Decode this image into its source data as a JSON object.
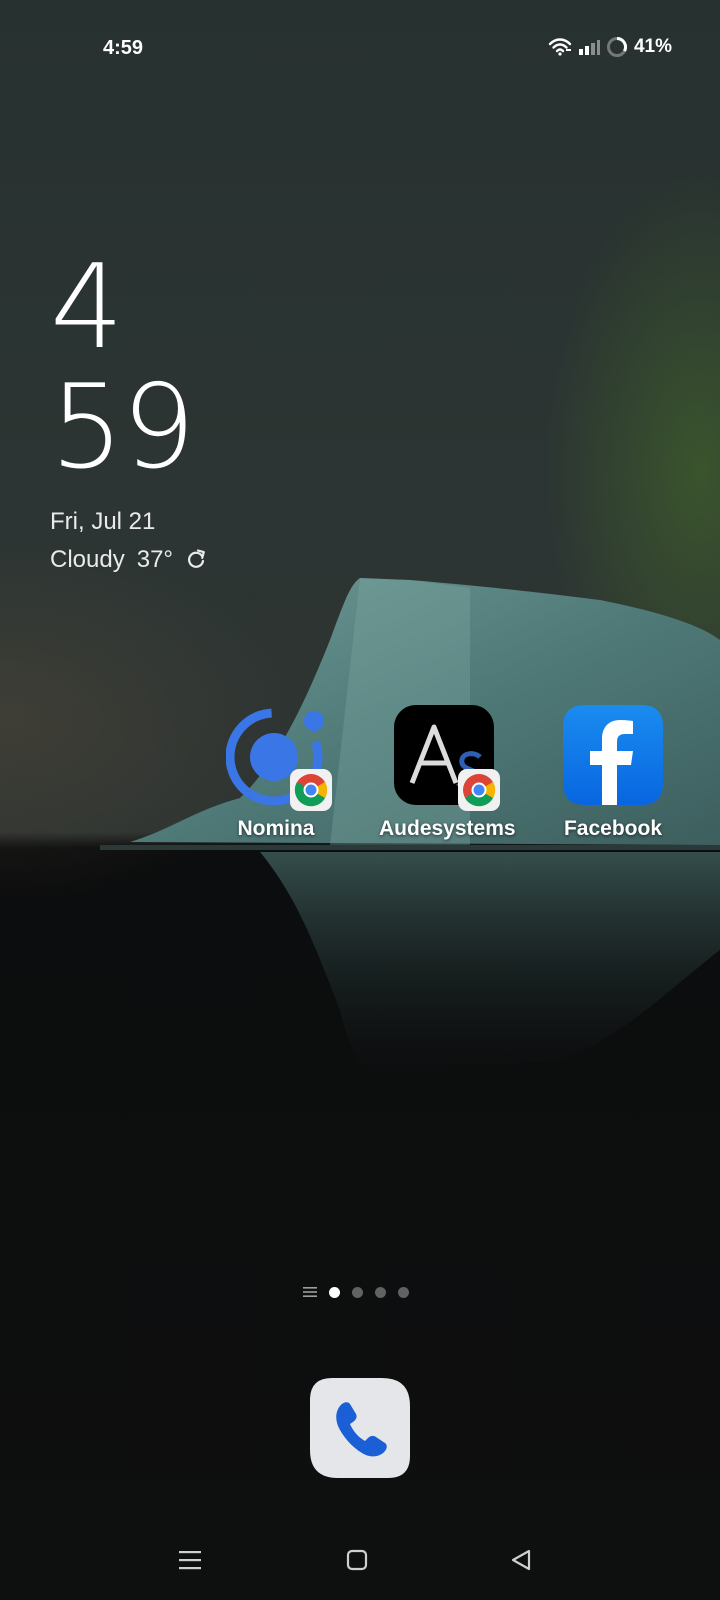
{
  "status_bar": {
    "time": "4:59",
    "battery_percent": "41%",
    "icons": [
      "wifi-icon",
      "signal-icon",
      "battery-ring-icon"
    ]
  },
  "clock_widget": {
    "hour": "4",
    "minute": "59",
    "date": "Fri, Jul 21",
    "weather_condition": "Cloudy",
    "temperature": "37°",
    "refresh_icon": "refresh-icon"
  },
  "apps": [
    {
      "label": "Nomina",
      "icon": "nomina-icon",
      "badge": "chrome-badge-icon"
    },
    {
      "label": "Audesystems",
      "icon": "audesystems-icon",
      "badge": "chrome-badge-icon"
    },
    {
      "label": "Facebook",
      "icon": "facebook-icon"
    }
  ],
  "page_indicator": {
    "pages": 4,
    "active_page": 1,
    "list_icon": "app-drawer-lines-icon"
  },
  "dock": [
    {
      "icon": "phone-icon"
    }
  ],
  "nav_bar": [
    "menu-icon",
    "home-icon",
    "back-icon"
  ],
  "colors": {
    "facebook_blue": "#1877F2",
    "nomina_blue": "#3a76e6",
    "phone_blue": "#1a5fd6"
  }
}
